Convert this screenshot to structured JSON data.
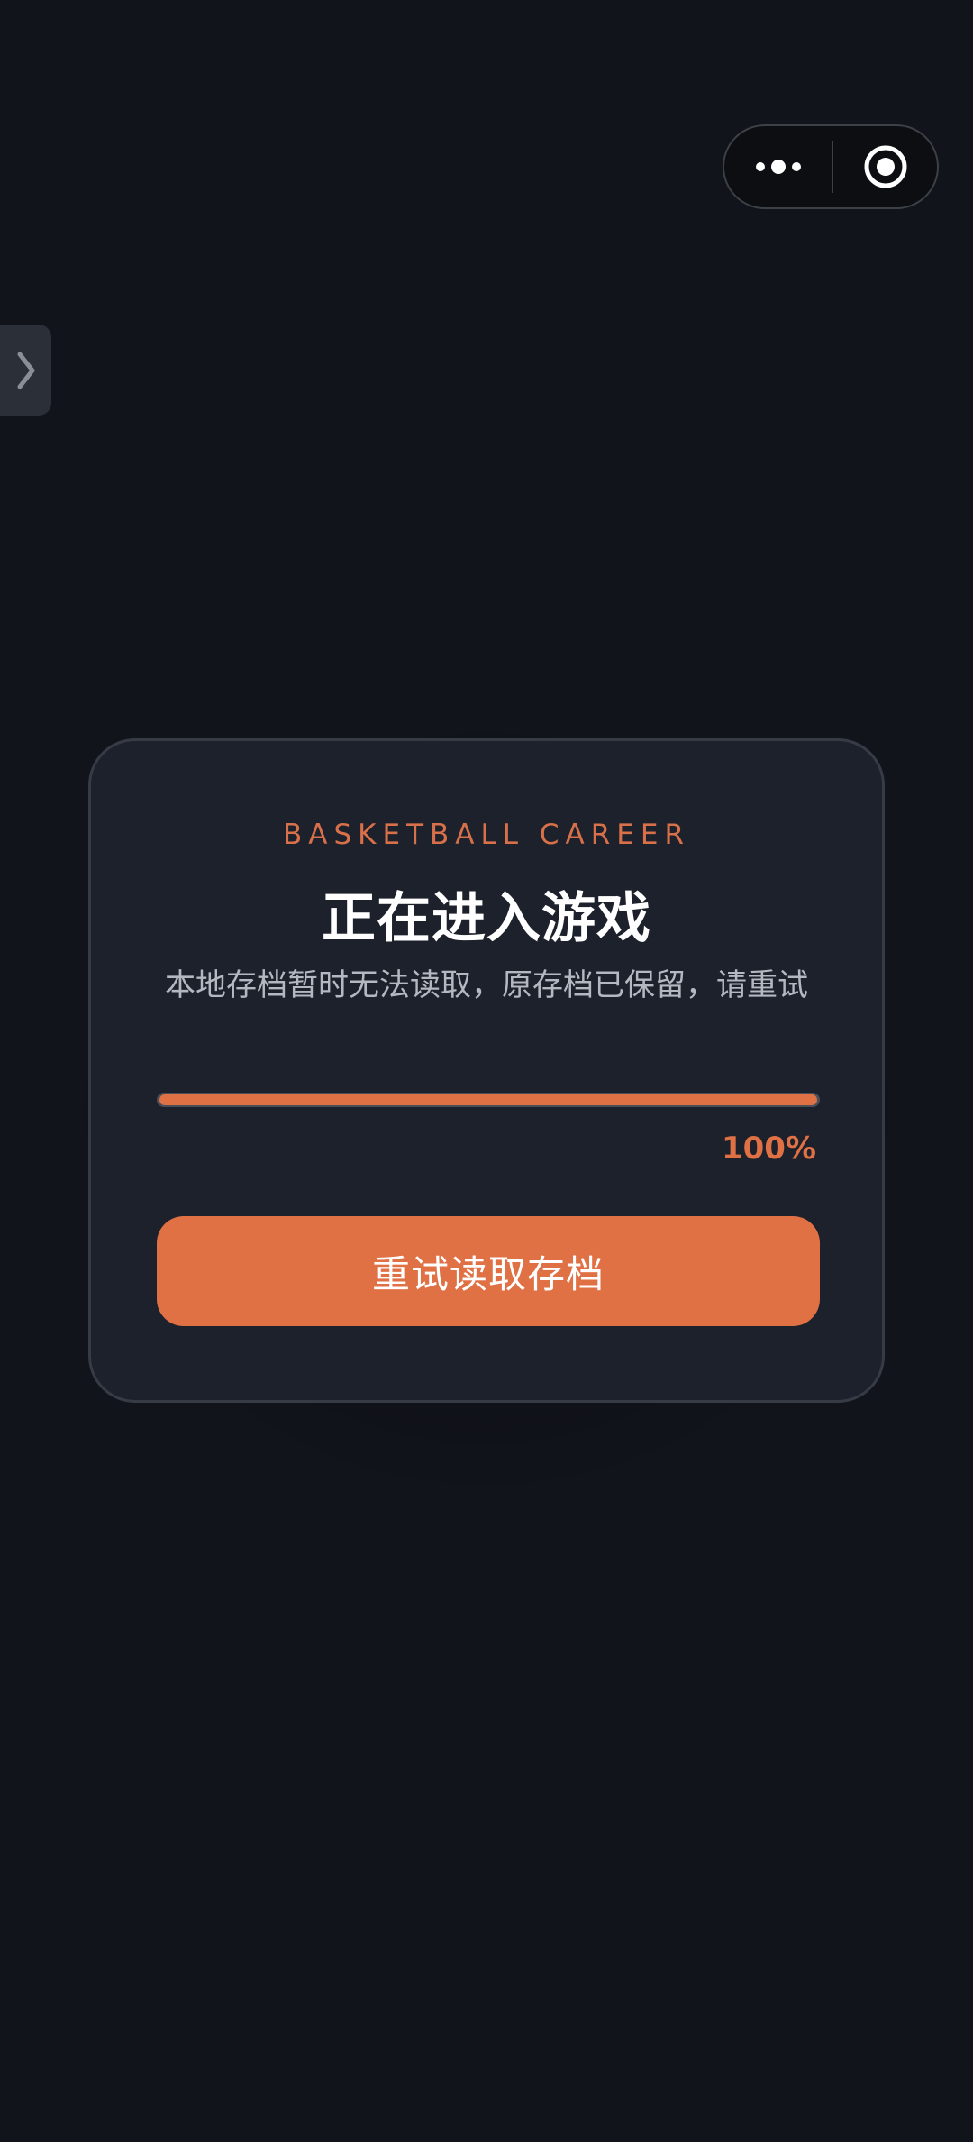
{
  "capsule": {
    "more_icon": "more-dots-icon",
    "close_icon": "target-close-icon"
  },
  "side_tab": {
    "icon": "chevron-right-icon"
  },
  "card": {
    "eyebrow": "BASKETBALL CAREER",
    "title": "正在进入游戏",
    "subtitle": "本地存档暂时无法读取，原存档已保留，请重试",
    "progress": {
      "value": 1.0,
      "label": "100%"
    },
    "retry_button_label": "重试读取存档"
  },
  "colors": {
    "background": "#11141b",
    "card": "#1d212b",
    "accent": "#e07145",
    "subtitle_text": "#b4b8c0"
  }
}
